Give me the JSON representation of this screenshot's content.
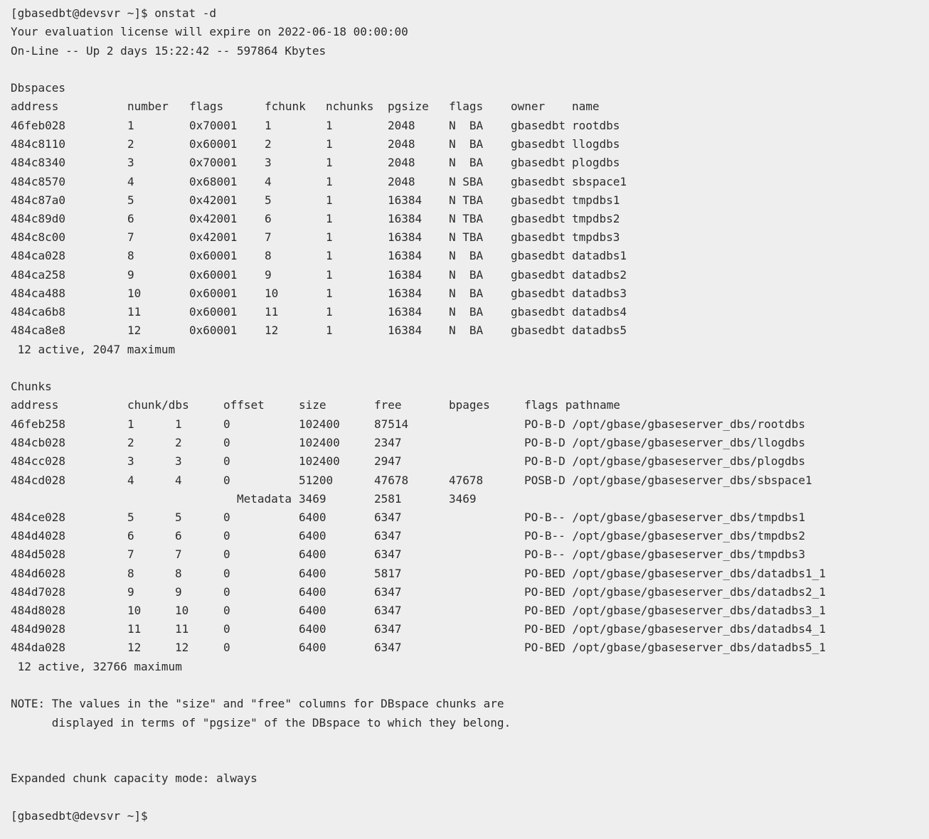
{
  "terminal": {
    "prompt": "[gbasedbt@devsvr ~]$ onstat -d",
    "license": "Your evaluation license will expire on 2022-06-18 00:00:00",
    "status": "On-Line -- Up 2 days 15:22:42 -- 597864 Kbytes",
    "dbspaces_title": "Dbspaces",
    "dbspaces_headers": [
      "address",
      "number",
      "flags",
      "fchunk",
      "nchunks",
      "pgsize",
      "flags",
      "owner",
      "name"
    ],
    "dbspaces": [
      [
        "46feb028",
        "1",
        "0x70001",
        "1",
        "1",
        "2048",
        "N  BA",
        "gbasedbt",
        "rootdbs"
      ],
      [
        "484c8110",
        "2",
        "0x60001",
        "2",
        "1",
        "2048",
        "N  BA",
        "gbasedbt",
        "llogdbs"
      ],
      [
        "484c8340",
        "3",
        "0x70001",
        "3",
        "1",
        "2048",
        "N  BA",
        "gbasedbt",
        "plogdbs"
      ],
      [
        "484c8570",
        "4",
        "0x68001",
        "4",
        "1",
        "2048",
        "N SBA",
        "gbasedbt",
        "sbspace1"
      ],
      [
        "484c87a0",
        "5",
        "0x42001",
        "5",
        "1",
        "16384",
        "N TBA",
        "gbasedbt",
        "tmpdbs1"
      ],
      [
        "484c89d0",
        "6",
        "0x42001",
        "6",
        "1",
        "16384",
        "N TBA",
        "gbasedbt",
        "tmpdbs2"
      ],
      [
        "484c8c00",
        "7",
        "0x42001",
        "7",
        "1",
        "16384",
        "N TBA",
        "gbasedbt",
        "tmpdbs3"
      ],
      [
        "484ca028",
        "8",
        "0x60001",
        "8",
        "1",
        "16384",
        "N  BA",
        "gbasedbt",
        "datadbs1"
      ],
      [
        "484ca258",
        "9",
        "0x60001",
        "9",
        "1",
        "16384",
        "N  BA",
        "gbasedbt",
        "datadbs2"
      ],
      [
        "484ca488",
        "10",
        "0x60001",
        "10",
        "1",
        "16384",
        "N  BA",
        "gbasedbt",
        "datadbs3"
      ],
      [
        "484ca6b8",
        "11",
        "0x60001",
        "11",
        "1",
        "16384",
        "N  BA",
        "gbasedbt",
        "datadbs4"
      ],
      [
        "484ca8e8",
        "12",
        "0x60001",
        "12",
        "1",
        "16384",
        "N  BA",
        "gbasedbt",
        "datadbs5"
      ]
    ],
    "dbspaces_summary": " 12 active, 2047 maximum",
    "chunks_title": "Chunks",
    "chunks_headers": [
      "address",
      "chunk/dbs",
      "offset",
      "size",
      "free",
      "bpages",
      "flags pathname"
    ],
    "chunks": [
      [
        "46feb258",
        "1",
        "1",
        "0",
        "102400",
        "87514",
        "",
        "PO-B-D /opt/gbase/gbaseserver_dbs/rootdbs"
      ],
      [
        "484cb028",
        "2",
        "2",
        "0",
        "102400",
        "2347",
        "",
        "PO-B-D /opt/gbase/gbaseserver_dbs/llogdbs"
      ],
      [
        "484cc028",
        "3",
        "3",
        "0",
        "102400",
        "2947",
        "",
        "PO-B-D /opt/gbase/gbaseserver_dbs/plogdbs"
      ],
      [
        "484cd028",
        "4",
        "4",
        "0",
        "51200",
        "47678",
        "47678",
        "POSB-D /opt/gbase/gbaseserver_dbs/sbspace1"
      ],
      [
        "484ce028",
        "5",
        "5",
        "0",
        "6400",
        "6347",
        "",
        "PO-B-- /opt/gbase/gbaseserver_dbs/tmpdbs1"
      ],
      [
        "484d4028",
        "6",
        "6",
        "0",
        "6400",
        "6347",
        "",
        "PO-B-- /opt/gbase/gbaseserver_dbs/tmpdbs2"
      ],
      [
        "484d5028",
        "7",
        "7",
        "0",
        "6400",
        "6347",
        "",
        "PO-B-- /opt/gbase/gbaseserver_dbs/tmpdbs3"
      ],
      [
        "484d6028",
        "8",
        "8",
        "0",
        "6400",
        "5817",
        "",
        "PO-BED /opt/gbase/gbaseserver_dbs/datadbs1_1"
      ],
      [
        "484d7028",
        "9",
        "9",
        "0",
        "6400",
        "6347",
        "",
        "PO-BED /opt/gbase/gbaseserver_dbs/datadbs2_1"
      ],
      [
        "484d8028",
        "10",
        "10",
        "0",
        "6400",
        "6347",
        "",
        "PO-BED /opt/gbase/gbaseserver_dbs/datadbs3_1"
      ],
      [
        "484d9028",
        "11",
        "11",
        "0",
        "6400",
        "6347",
        "",
        "PO-BED /opt/gbase/gbaseserver_dbs/datadbs4_1"
      ],
      [
        "484da028",
        "12",
        "12",
        "0",
        "6400",
        "6347",
        "",
        "PO-BED /opt/gbase/gbaseserver_dbs/datadbs5_1"
      ]
    ],
    "metadata_row": [
      "Metadata",
      "3469",
      "2581",
      "3469"
    ],
    "chunks_summary": " 12 active, 32766 maximum",
    "note_line1": "NOTE: The values in the \"size\" and \"free\" columns for DBspace chunks are",
    "note_line2": "      displayed in terms of \"pgsize\" of the DBspace to which they belong.",
    "expanded_mode": "Expanded chunk capacity mode: always",
    "final_prompt": "[gbasedbt@devsvr ~]$"
  }
}
